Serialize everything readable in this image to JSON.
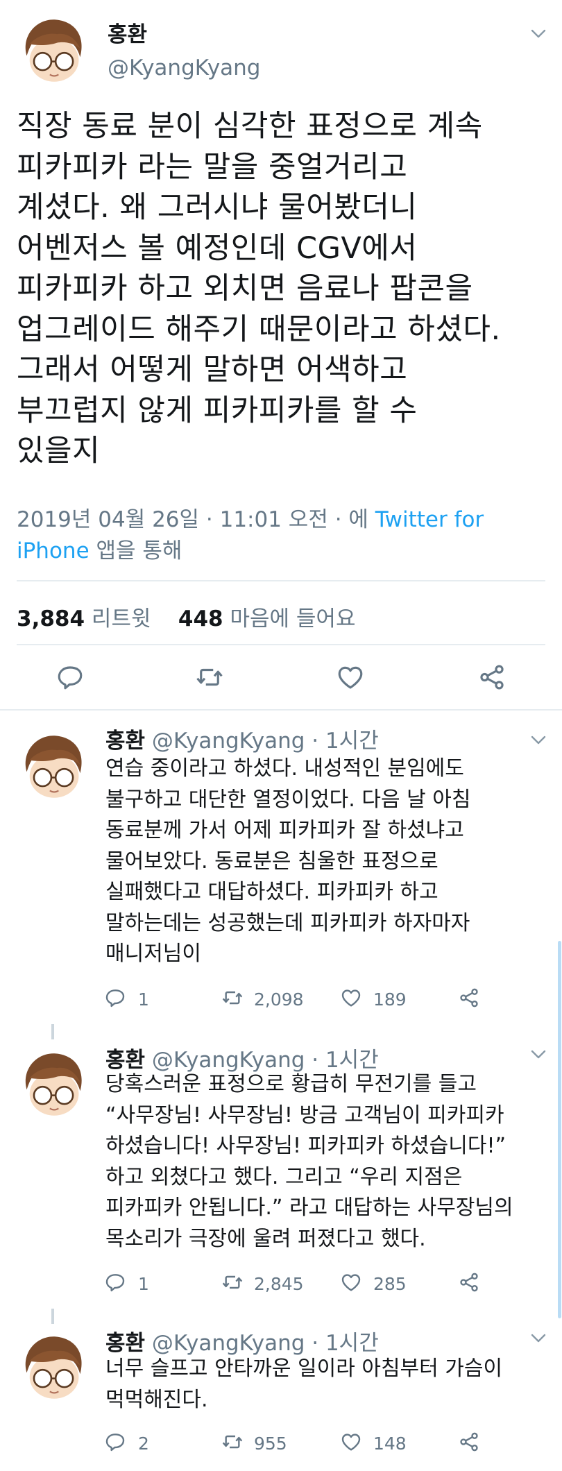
{
  "tweet": {
    "author_name": "홍환",
    "author_handle": "@KyangKyang",
    "lines": [
      "직장 동료 분이 심각한 표정으로 계속",
      "피카피카 라는 말을 중얼거리고",
      "계셨다. 왜 그러시냐 물어봤더니",
      "어벤저스 볼 예정인데 CGV에서",
      "피카피카 하고 외치면 음료나 팝콘을",
      "업그레이드 해주기 때문이라고 하셨다.",
      "그래서 어떻게 말하면 어색하고",
      "부끄럽지 않게 피카피카를 할 수",
      "있을지"
    ],
    "meta_line1": "2019년 04월 26일 · 11:01 오전 · 에 ",
    "meta_source_part1": "Twitter for",
    "meta_source_part2": "iPhone",
    "meta_line2_suffix": " 앱을 통해",
    "retweets_count": "3,884",
    "retweets_label": "리트윗",
    "likes_count": "448",
    "likes_label": "마음에 들어요"
  },
  "replies": [
    {
      "name": "홍환",
      "handle": "@KyangKyang",
      "time": "· 1시간",
      "lines": [
        "연습 중이라고 하셨다. 내성적인 분임에도",
        "불구하고 대단한 열정이었다. 다음 날 아침",
        "동료분께 가서 어제 피카피카 잘 하셨냐고",
        "물어보았다. 동료분은 침울한 표정으로",
        "실패했다고 대답하셨다. 피카피카 하고",
        "말하는데는 성공했는데 피카피카 하자마자",
        "매니저님이"
      ],
      "reply_count": "1",
      "retweet_count": "2,098",
      "like_count": "189"
    },
    {
      "name": "홍환",
      "handle": "@KyangKyang",
      "time": "· 1시간",
      "lines": [
        "당혹스러운 표정으로 황급히 무전기를 들고",
        "“사무장님! 사무장님! 방금 고객님이 피카피카",
        "하셨습니다! 사무장님! 피카피카 하셨습니다!”",
        "하고 외쳤다고 했다. 그리고 “우리 지점은",
        "피카피카 안됩니다.” 라고 대답하는 사무장님의",
        "목소리가 극장에 울려 퍼졌다고 했다."
      ],
      "reply_count": "1",
      "retweet_count": "2,845",
      "like_count": "285"
    },
    {
      "name": "홍환",
      "handle": "@KyangKyang",
      "time": "· 1시간",
      "lines": [
        "너무 슬프고 안타까운 일이라 아침부터 가슴이",
        "먹먹해진다."
      ],
      "reply_count": "2",
      "retweet_count": "955",
      "like_count": "148"
    }
  ],
  "colors": {
    "text": "#14171a",
    "secondary": "#657786",
    "link": "#1da1f2",
    "divider": "#e6ecf0"
  }
}
